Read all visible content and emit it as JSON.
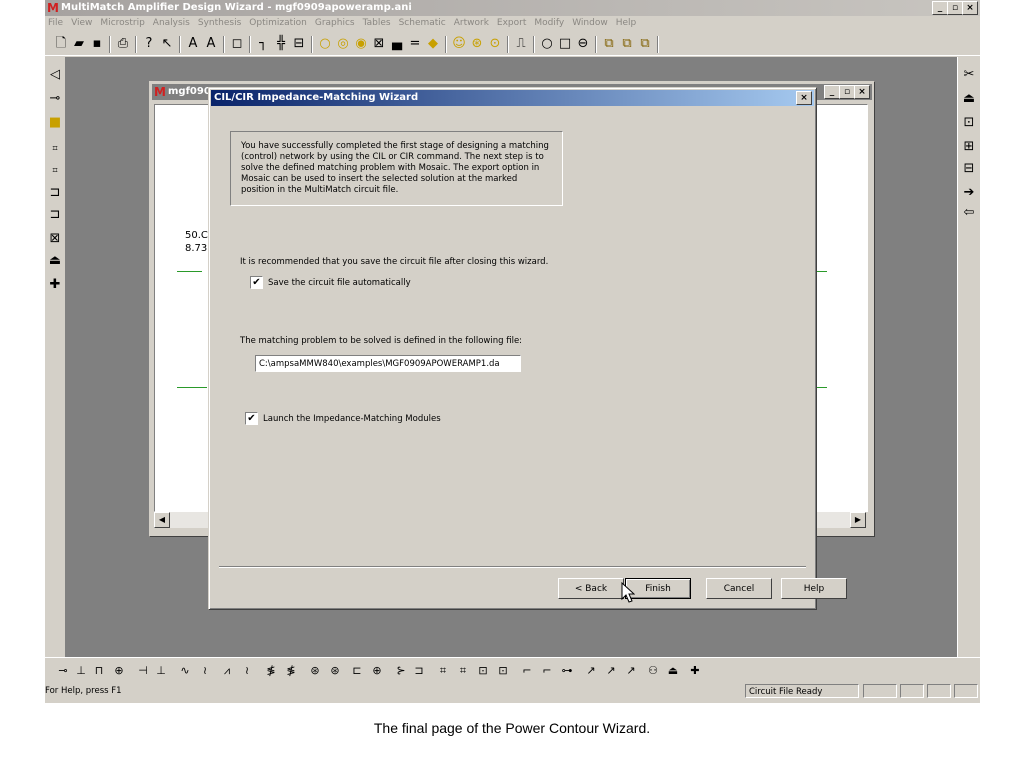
{
  "app": {
    "title": "MultiMatch Amplifier Design Wizard - mgf0909apoweramp.ani",
    "logo": "M",
    "menu": [
      "File",
      "View",
      "Microstrip",
      "Analysis",
      "Synthesis",
      "Optimization",
      "Graphics",
      "Tables",
      "Schematic",
      "Artwork",
      "Export",
      "Modify",
      "Window",
      "Help"
    ],
    "window_buttons": [
      "_",
      "▫",
      "×"
    ]
  },
  "toolbar_icons": [
    "new-file-icon",
    "open-folder-icon",
    "save-icon",
    "print-icon",
    "help-icon",
    "context-help-icon",
    "text-a-icon",
    "text-a2-icon",
    "frame-icon",
    "component-icon",
    "port-icon",
    "box-icon",
    "circle-icon",
    "circle2-icon",
    "target-icon",
    "x-box-icon",
    "bar-icon",
    "equal-icon",
    "shield-icon",
    "smile-icon",
    "s-circle-icon",
    "dot-circle-icon",
    "pulse-icon",
    "ring-icon",
    "square-icon",
    "ellipse-icon",
    "group-icon",
    "group2-icon",
    "group3-icon"
  ],
  "child": {
    "title": "mgf090",
    "schematic_text": [
      "50.C",
      "8.73"
    ]
  },
  "wizard": {
    "title": "CIL/CIR Impedance-Matching Wizard",
    "close": "×",
    "intro": "You have successfully completed the first stage of designing a matching (control) network by using the CIL or CIR command. The next step is to solve the defined matching problem with Mosaic. The export option in Mosaic can be used to insert the selected solution at the marked position in the MultiMatch circuit file.",
    "recommend": "It is recommended that you save the circuit file after closing this wizard.",
    "save_auto": "Save the circuit file automatically",
    "save_auto_checked": "✔",
    "problem_label": "The matching problem to be solved is defined in the following file:",
    "file_path": "C:\\ampsaMMW840\\examples\\MGF0909APOWERAMP1.da",
    "launch": "Launch the Impedance-Matching Modules",
    "launch_checked": "✔",
    "buttons": {
      "back": "< Back",
      "finish": "Finish",
      "cancel": "Cancel",
      "help": "Help"
    }
  },
  "status": {
    "help": "For Help, press F1",
    "state": "Circuit File Ready"
  },
  "caption": "The final page of the Power Contour Wizard."
}
